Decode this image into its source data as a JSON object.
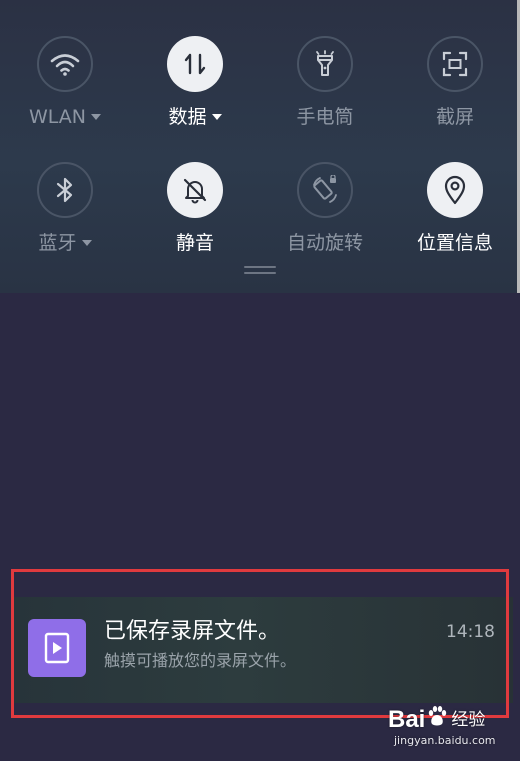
{
  "quick_settings": {
    "tiles": [
      {
        "label": "WLAN",
        "icon": "wifi-icon",
        "state": "off",
        "has_dropdown": true
      },
      {
        "label": "数据",
        "icon": "mobile-data-icon",
        "state": "on",
        "has_dropdown": true
      },
      {
        "label": "手电筒",
        "icon": "flashlight-icon",
        "state": "off",
        "has_dropdown": false
      },
      {
        "label": "截屏",
        "icon": "screenshot-icon",
        "state": "off",
        "has_dropdown": false
      },
      {
        "label": "蓝牙",
        "icon": "bluetooth-icon",
        "state": "off",
        "has_dropdown": true
      },
      {
        "label": "静音",
        "icon": "mute-bell-icon",
        "state": "on",
        "has_dropdown": false
      },
      {
        "label": "自动旋转",
        "icon": "auto-rotate-icon",
        "state": "disabled",
        "has_dropdown": false
      },
      {
        "label": "位置信息",
        "icon": "location-pin-icon",
        "state": "on",
        "has_dropdown": false
      }
    ]
  },
  "notification": {
    "title": "已保存录屏文件。",
    "body": "触摸可播放您的录屏文件。",
    "time": "14:18",
    "app_icon": "video-file-icon",
    "accent_color": "#8f6ee8"
  },
  "highlight_color": "#e03a3e",
  "watermark": {
    "brand_left": "Bai",
    "brand_right": "经验",
    "url": "jingyan.baidu.com"
  }
}
